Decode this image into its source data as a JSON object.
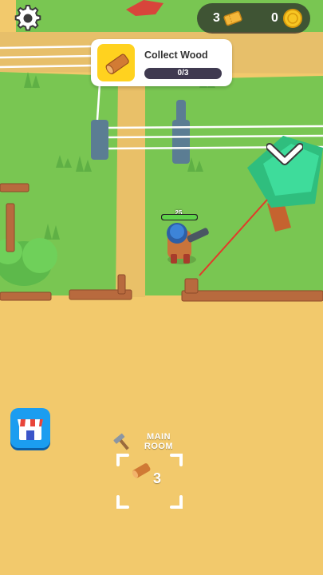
{
  "hud": {
    "tickets": "3",
    "coins": "0",
    "ticket_icon": "ticket-icon",
    "coin_icon": "coin-icon",
    "settings_icon": "gear-icon"
  },
  "quest": {
    "title": "Collect Wood",
    "progress_text": "0/3",
    "progress": 0,
    "icon": "wood-log-icon"
  },
  "player": {
    "level": "25",
    "health": 1
  },
  "build_zone": {
    "label_line1": "MAIN",
    "label_line2": "ROOM",
    "cost": "3",
    "icon": "hammer-icon",
    "resource_icon": "wood-log-icon"
  },
  "colors": {
    "sand": "#f2c96c",
    "grass": "#7cc953",
    "tree": "#36d69a",
    "accent": "#ffd21f",
    "shop": "#1b9df0"
  }
}
